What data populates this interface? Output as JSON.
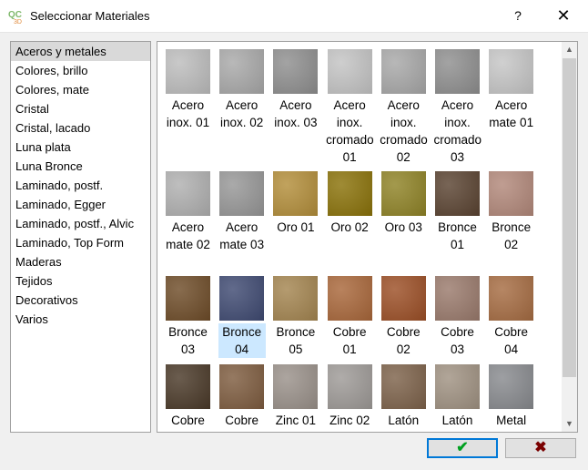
{
  "window": {
    "title": "Seleccionar Materiales",
    "help": "?",
    "close": "✕"
  },
  "categories": [
    "Aceros y metales",
    "Colores, brillo",
    "Colores, mate",
    "Cristal",
    "Cristal, lacado",
    "Luna plata",
    "Luna Bronce",
    "Laminado, postf.",
    "Laminado, Egger",
    "Laminado, postf., Alvic",
    "Laminado, Top Form",
    "Maderas",
    "Tejidos",
    "Decorativos",
    "Varios"
  ],
  "selected_category": "Aceros y metales",
  "materials": [
    {
      "label": "Acero inox. 01",
      "color": "#bdbdbd"
    },
    {
      "label": "Acero inox. 02",
      "color": "#a9a9a9"
    },
    {
      "label": "Acero inox. 03",
      "color": "#8f8f8f"
    },
    {
      "label": "Acero inox. cromado 01",
      "color": "#c4c4c4"
    },
    {
      "label": "Acero inox. cromado 02",
      "color": "#a8a8a8"
    },
    {
      "label": "Acero inox. cromado 03",
      "color": "#8f8f8f"
    },
    {
      "label": "Acero mate 01",
      "color": "#c6c6c6"
    },
    {
      "label": "Acero mate 02",
      "color": "#b0b0b0"
    },
    {
      "label": "Acero mate 03",
      "color": "#979797"
    },
    {
      "label": "Oro 01",
      "color": "#b38e3a"
    },
    {
      "label": "Oro 02",
      "color": "#8a7209"
    },
    {
      "label": "Oro 03",
      "color": "#8f8326"
    },
    {
      "label": "Bronce 01",
      "color": "#5a4331"
    },
    {
      "label": "Bronce 02",
      "color": "#b2887a"
    },
    {
      "label": "Bronce 03",
      "color": "#6e4c28"
    },
    {
      "label": "Bronce 04",
      "color": "#3f4a72"
    },
    {
      "label": "Bronce 05",
      "color": "#a48550"
    },
    {
      "label": "Cobre 01",
      "color": "#a9673a"
    },
    {
      "label": "Cobre 02",
      "color": "#9c4f26"
    },
    {
      "label": "Cobre 03",
      "color": "#9a7a6c"
    },
    {
      "label": "Cobre 04",
      "color": "#a66c42"
    },
    {
      "label": "Cobre",
      "color": "#4a3928"
    },
    {
      "label": "Cobre",
      "color": "#7e5c3f"
    },
    {
      "label": "Zinc 01",
      "color": "#9a918a"
    },
    {
      "label": "Zinc 02",
      "color": "#9e9a97"
    },
    {
      "label": "Latón",
      "color": "#7d624a"
    },
    {
      "label": "Latón",
      "color": "#a09282"
    },
    {
      "label": "Metal",
      "color": "#888a8e"
    }
  ],
  "selected_material": "Bronce 04",
  "buttons": {
    "ok": "✔",
    "cancel": "✖"
  },
  "colors": {
    "ok_check": "#00a020",
    "cancel_x": "#7a0000",
    "focus": "#0078d7",
    "selection": "#cce8ff"
  }
}
